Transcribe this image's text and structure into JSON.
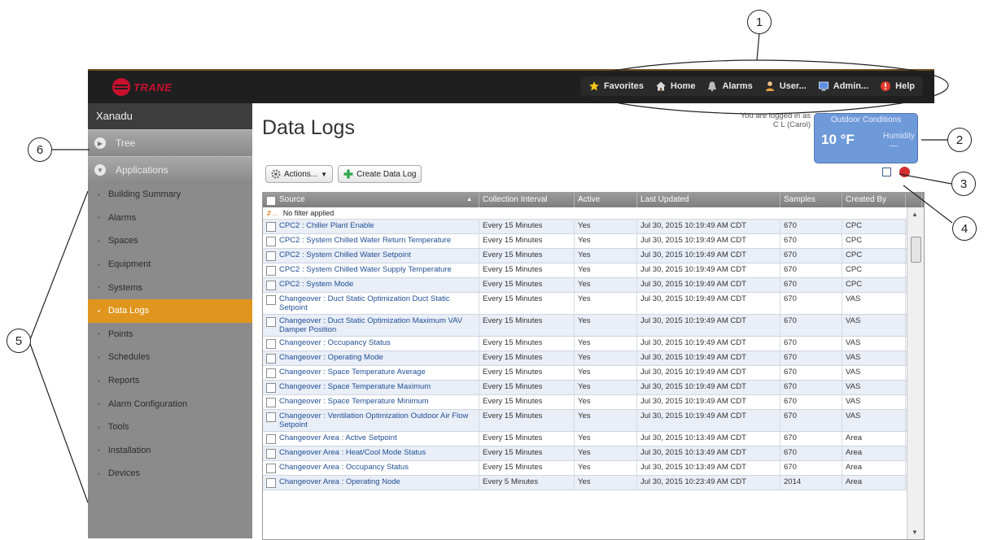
{
  "callouts": [
    "1",
    "2",
    "3",
    "4",
    "5",
    "6"
  ],
  "brand": {
    "logo_text": "TRANE",
    "logo_color": "#c8102e"
  },
  "nav": [
    {
      "label": "Favorites",
      "icon": "star-icon"
    },
    {
      "label": "Home",
      "icon": "home-icon"
    },
    {
      "label": "Alarms",
      "icon": "bell-icon"
    },
    {
      "label": "User...",
      "icon": "user-icon"
    },
    {
      "label": "Admin...",
      "icon": "admin-icon"
    },
    {
      "label": "Help",
      "icon": "help-icon"
    }
  ],
  "sidebar": {
    "site_name": "Xanadu",
    "tree_label": "Tree",
    "applications_label": "Applications",
    "active_item": "Data Logs",
    "items": [
      "Building Summary",
      "Alarms",
      "Spaces",
      "Equipment",
      "Systems",
      "Data Logs",
      "Points",
      "Schedules",
      "Reports",
      "Alarm Configuration",
      "Tools",
      "Installation",
      "Devices"
    ]
  },
  "page": {
    "title": "Data Logs",
    "login_line1": "You are logged in as",
    "login_line2": "C L (Carol)"
  },
  "outdoor": {
    "title": "Outdoor Conditions",
    "temp": "10 °F",
    "humidity_label": "Humidity",
    "humidity_value": "—"
  },
  "toolbar": {
    "actions_label": "Actions...",
    "create_label": "Create Data Log"
  },
  "table": {
    "headers": [
      "Source",
      "Collection Interval",
      "Active",
      "Last Updated",
      "Samples",
      "Created By"
    ],
    "filter_text": "No filter applied",
    "rows": [
      {
        "source": "CPC2 : Chiller Plant Enable",
        "interval": "Every 15 Minutes",
        "active": "Yes",
        "updated": "Jul 30, 2015 10:19:49 AM CDT",
        "samples": "670",
        "by": "CPC"
      },
      {
        "source": "CPC2 : System Chilled Water Return Temperature",
        "interval": "Every 15 Minutes",
        "active": "Yes",
        "updated": "Jul 30, 2015 10:19:49 AM CDT",
        "samples": "670",
        "by": "CPC"
      },
      {
        "source": "CPC2 : System Chilled Water Setpoint",
        "interval": "Every 15 Minutes",
        "active": "Yes",
        "updated": "Jul 30, 2015 10:19:49 AM CDT",
        "samples": "670",
        "by": "CPC"
      },
      {
        "source": "CPC2 : System Chilled Water Supply Temperature",
        "interval": "Every 15 Minutes",
        "active": "Yes",
        "updated": "Jul 30, 2015 10:19:49 AM CDT",
        "samples": "670",
        "by": "CPC"
      },
      {
        "source": "CPC2 : System Mode",
        "interval": "Every 15 Minutes",
        "active": "Yes",
        "updated": "Jul 30, 2015 10:19:49 AM CDT",
        "samples": "670",
        "by": "CPC"
      },
      {
        "source": "Changeover : Duct Static Optimization Duct Static Setpoint",
        "interval": "Every 15 Minutes",
        "active": "Yes",
        "updated": "Jul 30, 2015 10:19:49 AM CDT",
        "samples": "670",
        "by": "VAS"
      },
      {
        "source": "Changeover : Duct Static Optimization Maximum VAV Damper Position",
        "interval": "Every 15 Minutes",
        "active": "Yes",
        "updated": "Jul 30, 2015 10:19:49 AM CDT",
        "samples": "670",
        "by": "VAS"
      },
      {
        "source": "Changeover : Occupancy Status",
        "interval": "Every 15 Minutes",
        "active": "Yes",
        "updated": "Jul 30, 2015 10:19:49 AM CDT",
        "samples": "670",
        "by": "VAS"
      },
      {
        "source": "Changeover : Operating Mode",
        "interval": "Every 15 Minutes",
        "active": "Yes",
        "updated": "Jul 30, 2015 10:19:49 AM CDT",
        "samples": "670",
        "by": "VAS"
      },
      {
        "source": "Changeover : Space Temperature Average",
        "interval": "Every 15 Minutes",
        "active": "Yes",
        "updated": "Jul 30, 2015 10:19:49 AM CDT",
        "samples": "670",
        "by": "VAS"
      },
      {
        "source": "Changeover : Space Temperature Maximum",
        "interval": "Every 15 Minutes",
        "active": "Yes",
        "updated": "Jul 30, 2015 10:19:49 AM CDT",
        "samples": "670",
        "by": "VAS"
      },
      {
        "source": "Changeover : Space Temperature Minimum",
        "interval": "Every 15 Minutes",
        "active": "Yes",
        "updated": "Jul 30, 2015 10:19:49 AM CDT",
        "samples": "670",
        "by": "VAS"
      },
      {
        "source": "Changeover : Ventilation Optimization Outdoor Air Flow Setpoint",
        "interval": "Every 15 Minutes",
        "active": "Yes",
        "updated": "Jul 30, 2015 10:19:49 AM CDT",
        "samples": "670",
        "by": "VAS"
      },
      {
        "source": "Changeover Area : Active Setpoint",
        "interval": "Every 15 Minutes",
        "active": "Yes",
        "updated": "Jul 30, 2015 10:13:49 AM CDT",
        "samples": "670",
        "by": "Area"
      },
      {
        "source": "Changeover Area : Heat/Cool Mode Status",
        "interval": "Every 15 Minutes",
        "active": "Yes",
        "updated": "Jul 30, 2015 10:13:49 AM CDT",
        "samples": "670",
        "by": "Area"
      },
      {
        "source": "Changeover Area : Occupancy Status",
        "interval": "Every 15 Minutes",
        "active": "Yes",
        "updated": "Jul 30, 2015 10:13:49 AM CDT",
        "samples": "670",
        "by": "Area"
      },
      {
        "source": "Changeover Area : Operating Node",
        "interval": "Every 5 Minutes",
        "active": "Yes",
        "updated": "Jul 30, 2015 10:23:49 AM CDT",
        "samples": "2014",
        "by": "Area"
      }
    ]
  }
}
